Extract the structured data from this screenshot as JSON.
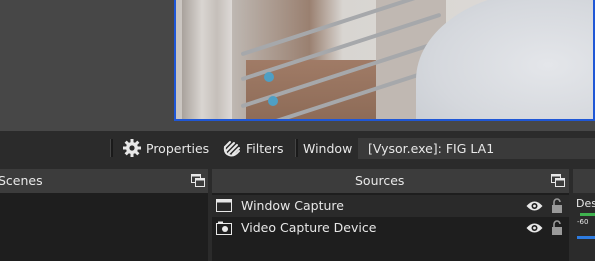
{
  "toolbar": {
    "properties_label": "Properties",
    "filters_label": "Filters",
    "window_label": "Window",
    "window_value": "[Vysor.exe]: FIG LA1"
  },
  "docks": {
    "scenes_title": "Scenes",
    "sources_title": "Sources"
  },
  "sources": [
    {
      "label": "Window Capture",
      "icon": "window-icon"
    },
    {
      "label": "Video Capture Device",
      "icon": "camera-icon"
    }
  ],
  "mixer": {
    "device_label": "Des",
    "scale_label": "-60"
  },
  "colors": {
    "selection_border": "#1f57d6",
    "background": "#2b2b2b",
    "panel_header": "#3c3c3c",
    "list_background": "#1e1e1e",
    "meter_green": "#3fb34f",
    "meter_blue": "#2d7be0"
  }
}
